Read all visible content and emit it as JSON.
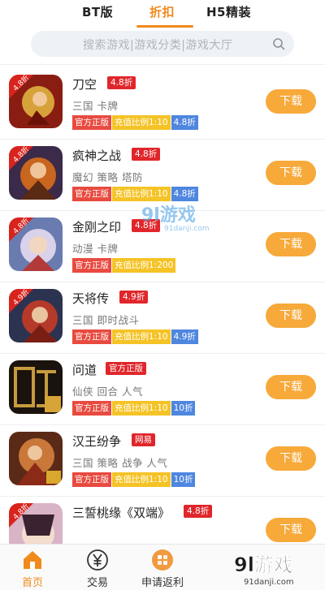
{
  "tabs": [
    {
      "label": "BT版",
      "active": false
    },
    {
      "label": "折扣",
      "active": true
    },
    {
      "label": "H5精装",
      "active": false
    }
  ],
  "search": {
    "placeholder": "搜索游戏|游戏分类|游戏大厅"
  },
  "games": [
    {
      "name": "刀空",
      "discount": "4.8折",
      "tags": "三国 卡牌",
      "badges": [
        "官方正版",
        "充值比例1:10",
        "4.8折"
      ],
      "download": "下载",
      "thumb_ribbon": "4.8折"
    },
    {
      "name": "疯神之战",
      "discount": "4.8折",
      "tags": "魔幻 策略 塔防",
      "badges": [
        "官方正版",
        "充值比例1:10",
        "4.8折"
      ],
      "download": "下载",
      "thumb_ribbon": "4.8折"
    },
    {
      "name": "金刚之印",
      "discount": "4.8折",
      "tags": "动漫 卡牌",
      "badges": [
        "官方正版",
        "充值比例1:200"
      ],
      "download": "下载",
      "thumb_ribbon": "4.8折"
    },
    {
      "name": "天将传",
      "discount": "4.9折",
      "tags": "三国 即时战斗",
      "badges": [
        "官方正版",
        "充值比例1:10",
        "4.9折"
      ],
      "download": "下载",
      "thumb_ribbon": "4.9折"
    },
    {
      "name": "问道",
      "discount": "官方正版",
      "tags": "仙侠 回合 人气",
      "badges": [
        "官方正版",
        "充值比例1:10",
        "10折"
      ],
      "download": "下载",
      "thumb_ribbon": ""
    },
    {
      "name": "汉王纷争",
      "discount": "网易",
      "tags": "三国 策略 战争 人气",
      "badges": [
        "官方正版",
        "充值比例1:10",
        "10折"
      ],
      "download": "下载",
      "thumb_ribbon": ""
    },
    {
      "name": "三誓桃缘《双端》",
      "discount": "4.8折",
      "tags": "",
      "badges": [],
      "download": "下载",
      "thumb_ribbon": "4.8折"
    }
  ],
  "bottom_nav": [
    {
      "label": "首页",
      "icon": "home-icon",
      "active": true
    },
    {
      "label": "交易",
      "icon": "yen-icon",
      "active": false
    },
    {
      "label": "申请返利",
      "icon": "rebate-icon",
      "active": false
    }
  ],
  "watermark": {
    "brand": "9l游戏",
    "domain": "91danji.com"
  },
  "colors": {
    "accent": "#f08a1c",
    "discount_red": "#e0262b",
    "download_orange": "#f7a93a",
    "badge_blue": "#4e86e0",
    "badge_yellow": "#f5c326",
    "badge_red": "#e84a3f"
  }
}
